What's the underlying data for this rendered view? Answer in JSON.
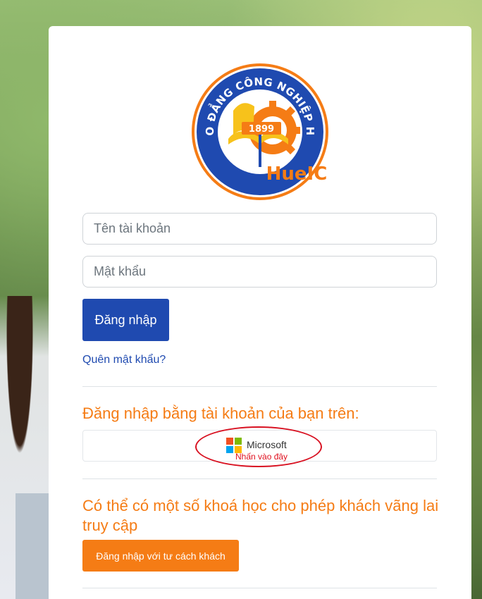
{
  "logo": {
    "arc_text": "CAO ĐẲNG CÔNG NGHIỆP HUẾ",
    "year": "1899",
    "brand": "HueIC",
    "colors": {
      "orange": "#f57c15",
      "blue": "#1f4ab0",
      "yellow": "#f7c21b"
    }
  },
  "login": {
    "username_placeholder": "Tên tài khoản",
    "password_placeholder": "Mật khẩu",
    "submit_label": "Đăng nhập",
    "forgot_link": "Quên mật khẩu?"
  },
  "external": {
    "heading": "Đăng nhập bằng tài khoản của bạn trên:",
    "microsoft_label": "Microsoft",
    "hint": "Nhấn vào đây"
  },
  "guest": {
    "heading": "Có thể có một số khoá học cho phép khách vãng lai truy cập",
    "button_label": "Đăng nhập với tư cách khách"
  },
  "colors": {
    "primary_blue": "#1f4ab0",
    "accent_orange": "#f57c15",
    "annotation_red": "#d81020"
  }
}
